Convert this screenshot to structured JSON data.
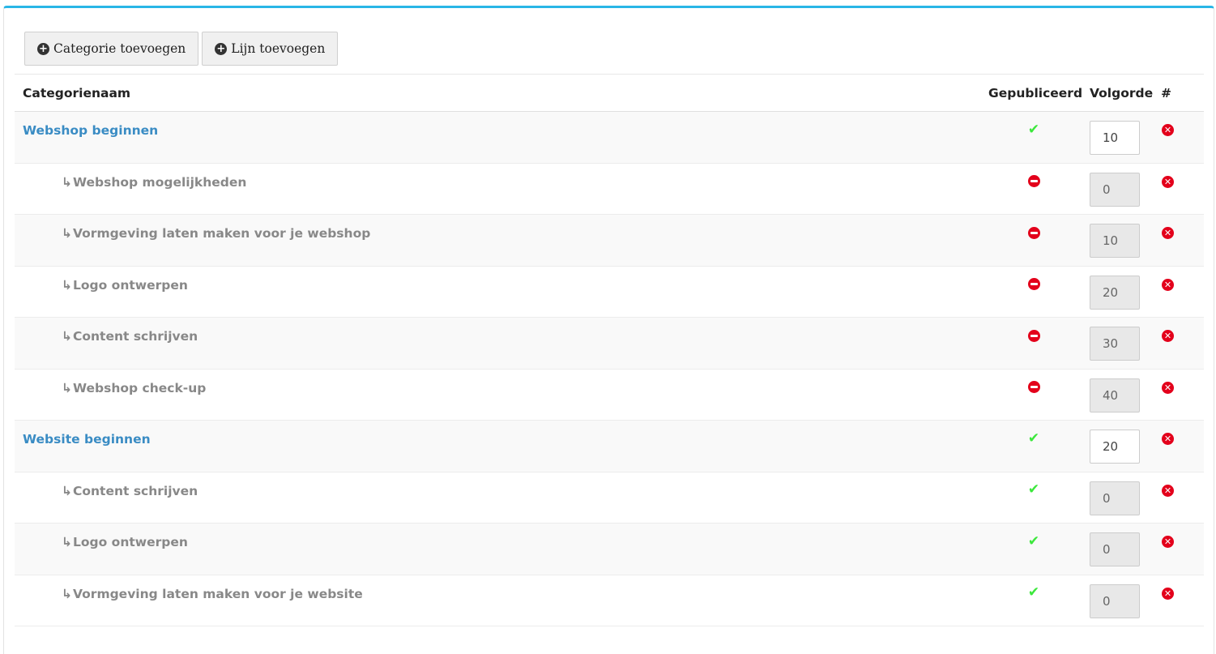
{
  "toolbar": {
    "add_category_label": "Categorie toevoegen",
    "add_line_label": "Lijn toevoegen"
  },
  "table": {
    "headers": {
      "name": "Categorienaam",
      "published": "Gepubliceerd",
      "order": "Volgorde",
      "actions": "#"
    },
    "rows": [
      {
        "name": "Webshop beginnen",
        "level": "parent",
        "published": true,
        "order": "10"
      },
      {
        "name": "Webshop mogelijkheden",
        "level": "child",
        "published": false,
        "order": "0"
      },
      {
        "name": "Vormgeving laten maken voor je webshop",
        "level": "child",
        "published": false,
        "order": "10"
      },
      {
        "name": "Logo ontwerpen",
        "level": "child",
        "published": false,
        "order": "20"
      },
      {
        "name": "Content schrijven",
        "level": "child",
        "published": false,
        "order": "30"
      },
      {
        "name": "Webshop check-up",
        "level": "child",
        "published": false,
        "order": "40"
      },
      {
        "name": "Website beginnen",
        "level": "parent",
        "published": true,
        "order": "20"
      },
      {
        "name": "Content schrijven",
        "level": "child",
        "published": true,
        "order": "0"
      },
      {
        "name": "Logo ontwerpen",
        "level": "child",
        "published": true,
        "order": "0"
      },
      {
        "name": "Vormgeving laten maken voor je website",
        "level": "child",
        "published": true,
        "order": "0"
      }
    ]
  },
  "icons": {
    "add": "plus-circle-icon",
    "published": "check-icon",
    "unpublished": "minus-circle-icon",
    "delete": "times-circle-icon",
    "child_arrow": "arrow-return-icon"
  },
  "colors": {
    "accent": "#29b6e6",
    "link": "#3a8cc4",
    "published": "#3ce83c",
    "danger": "#e3001b"
  }
}
